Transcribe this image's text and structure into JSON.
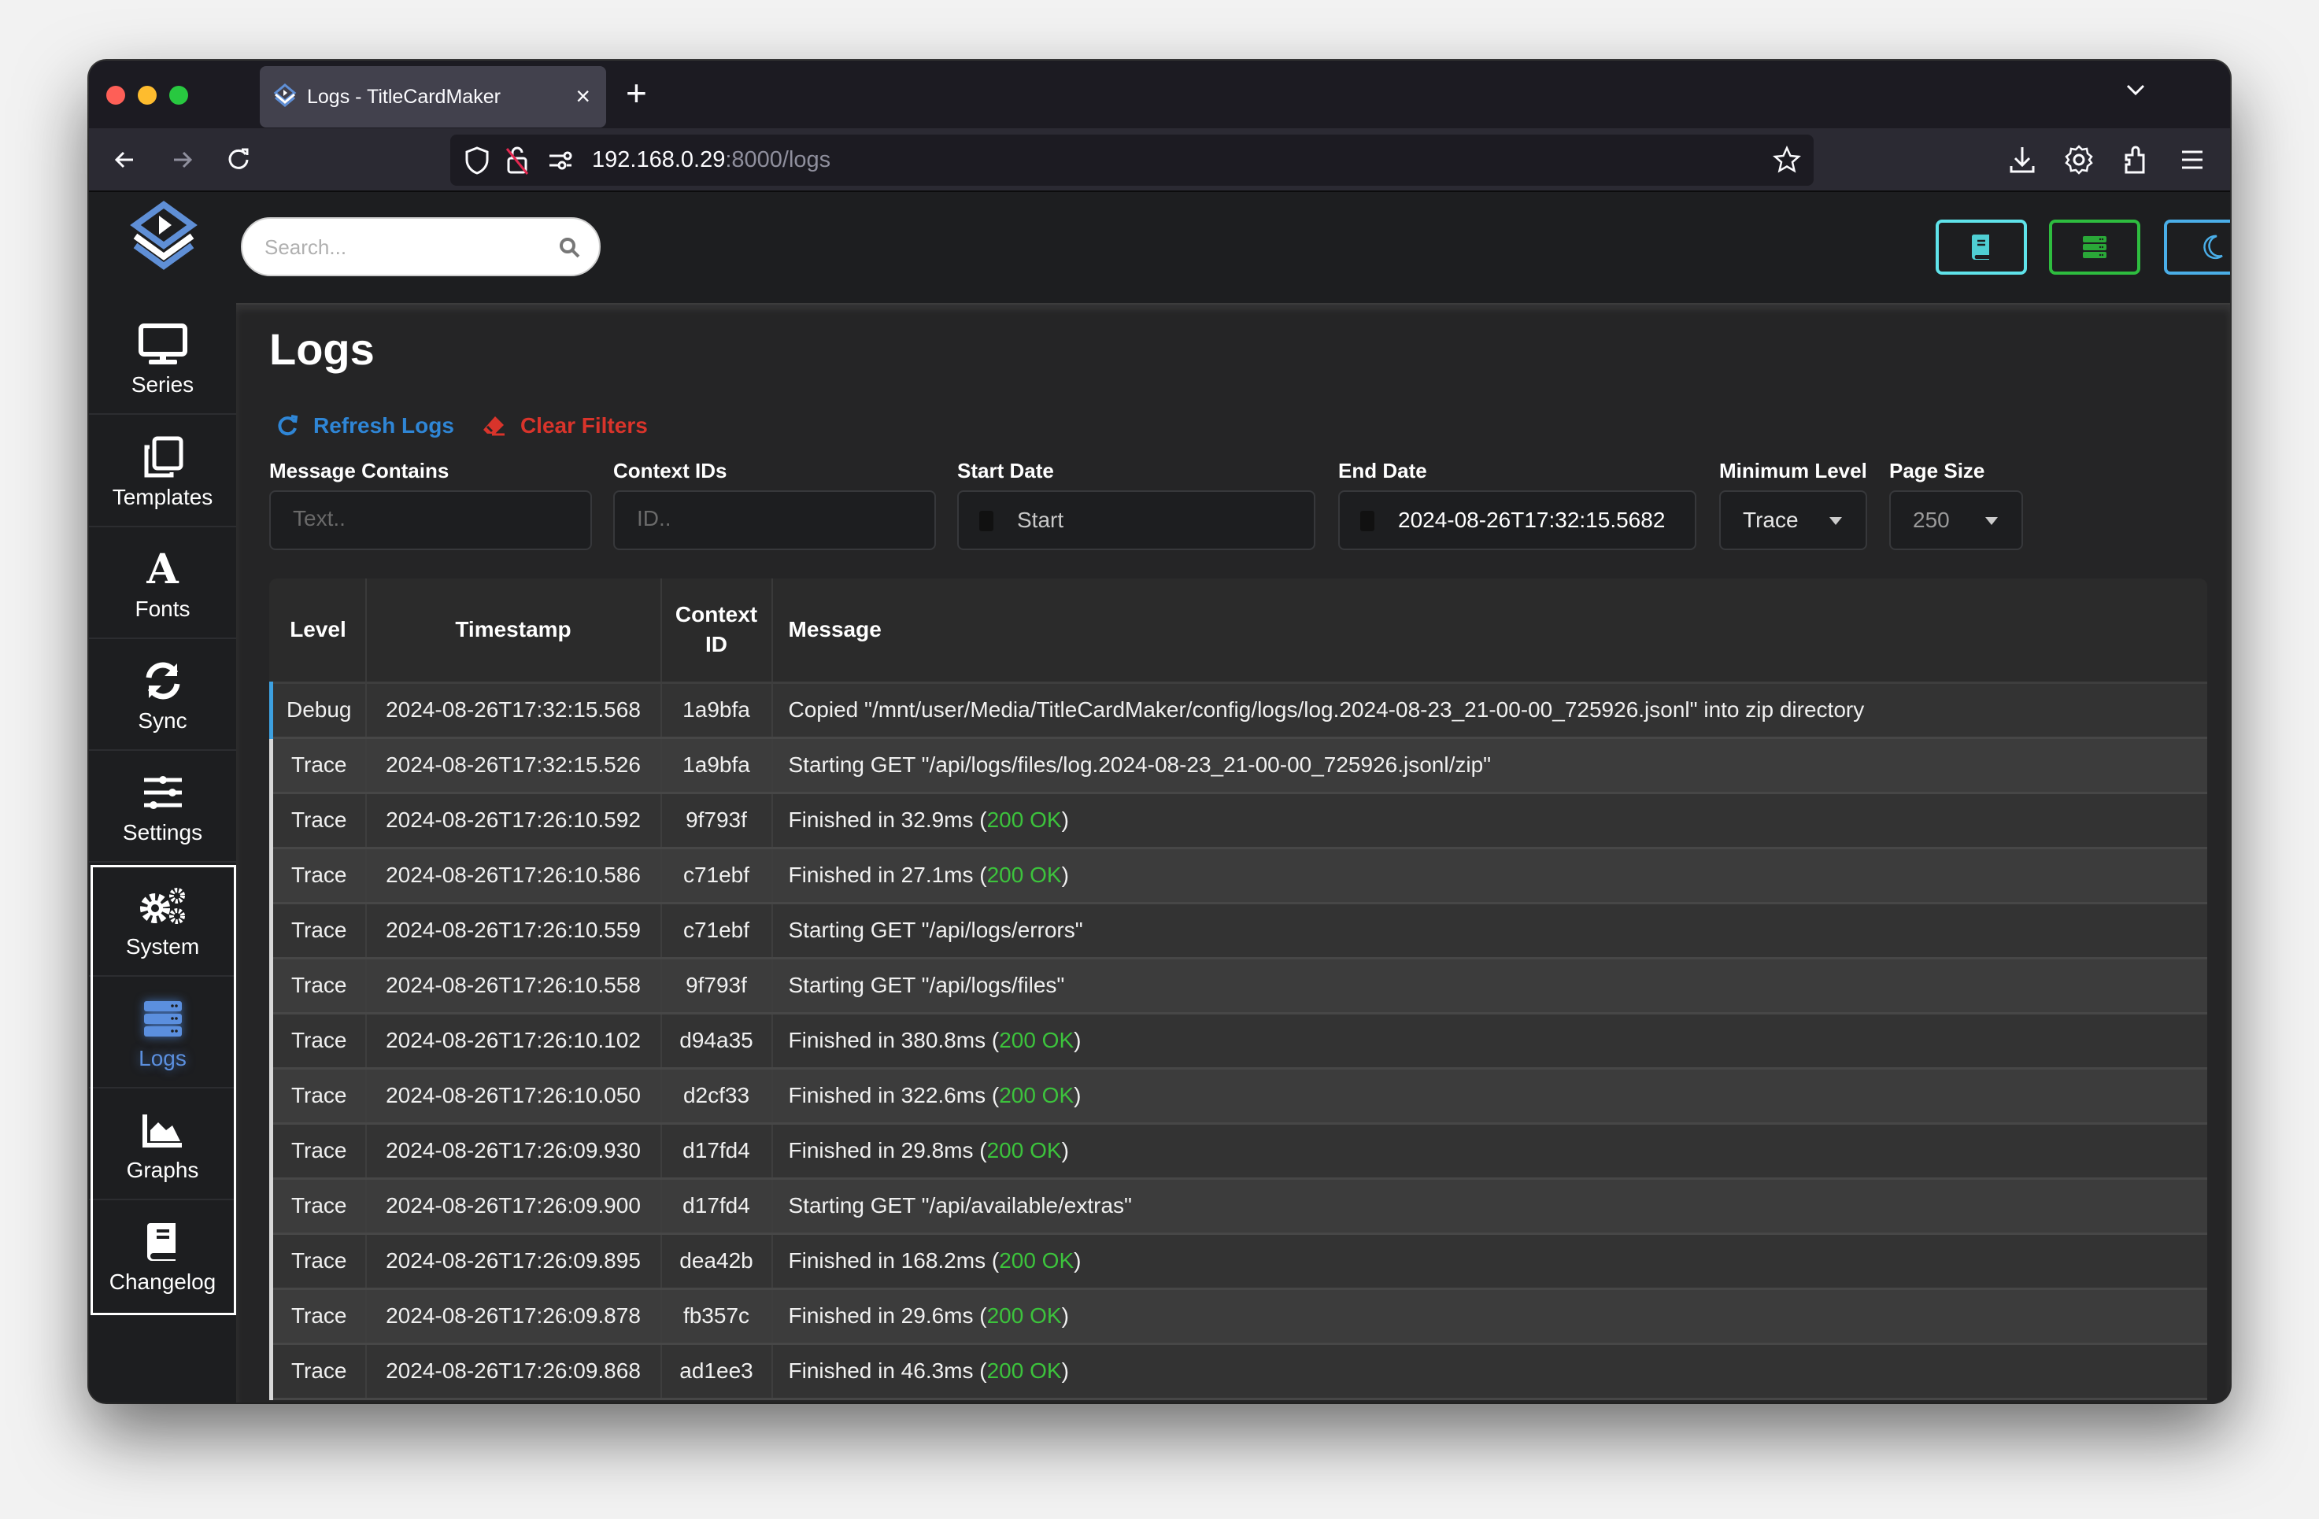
{
  "browser": {
    "tab_title": "Logs - TitleCardMaker",
    "url_host": "192.168.0.29",
    "url_path": ":8000/logs"
  },
  "app": {
    "search_placeholder": "Search...",
    "header_buttons": [
      {
        "name": "changelog-button",
        "icon": "book-icon",
        "color": "#5fe3ea"
      },
      {
        "name": "logs-button",
        "icon": "server-icon",
        "color": "#2ebd3f"
      },
      {
        "name": "theme-toggle-button",
        "icon": "moon-icon",
        "color": "#4aaee8"
      }
    ]
  },
  "sidebar": {
    "items": [
      {
        "label": "Series",
        "icon": "monitor-icon"
      },
      {
        "label": "Templates",
        "icon": "copy-icon"
      },
      {
        "label": "Fonts",
        "icon": "font-icon"
      },
      {
        "label": "Sync",
        "icon": "sync-icon"
      },
      {
        "label": "Settings",
        "icon": "sliders-icon"
      },
      {
        "label": "System",
        "icon": "gears-icon"
      },
      {
        "label": "Logs",
        "icon": "server-icon",
        "active": true
      },
      {
        "label": "Graphs",
        "icon": "chart-area-icon"
      },
      {
        "label": "Changelog",
        "icon": "book-icon"
      }
    ]
  },
  "page": {
    "title": "Logs",
    "refresh_label": "Refresh Logs",
    "clear_label": "Clear Filters",
    "colors": {
      "refresh": "#2f86d6",
      "clear": "#d9342b",
      "ok": "#3cc33c",
      "active": "#5b8fde"
    }
  },
  "filters": {
    "message_label": "Message Contains",
    "message_placeholder": "Text..",
    "context_label": "Context IDs",
    "context_placeholder": "ID..",
    "start_label": "Start Date",
    "start_placeholder": "Start",
    "end_label": "End Date",
    "end_value": "2024-08-26T17:32:15.5682",
    "level_label": "Minimum Level",
    "level_value": "Trace",
    "pagesize_label": "Page Size",
    "pagesize_value": "250"
  },
  "table": {
    "headers": {
      "level": "Level",
      "timestamp": "Timestamp",
      "context_l1": "Context",
      "context_l2": "ID",
      "message": "Message"
    },
    "rows": [
      {
        "level": "Debug",
        "timestamp": "2024-08-26T17:32:15.568",
        "context": "1a9bfa",
        "message": "Copied \"/mnt/user/Media/TitleCardMaker/config/logs/log.2024-08-23_21-00-00_725926.jsonl\" into zip directory",
        "status": ""
      },
      {
        "level": "Trace",
        "timestamp": "2024-08-26T17:32:15.526",
        "context": "1a9bfa",
        "message": "Starting GET \"/api/logs/files/log.2024-08-23_21-00-00_725926.jsonl/zip\"",
        "status": ""
      },
      {
        "level": "Trace",
        "timestamp": "2024-08-26T17:26:10.592",
        "context": "9f793f",
        "message": "Finished in 32.9ms (",
        "status": "200 OK"
      },
      {
        "level": "Trace",
        "timestamp": "2024-08-26T17:26:10.586",
        "context": "c71ebf",
        "message": "Finished in 27.1ms (",
        "status": "200 OK"
      },
      {
        "level": "Trace",
        "timestamp": "2024-08-26T17:26:10.559",
        "context": "c71ebf",
        "message": "Starting GET \"/api/logs/errors\"",
        "status": ""
      },
      {
        "level": "Trace",
        "timestamp": "2024-08-26T17:26:10.558",
        "context": "9f793f",
        "message": "Starting GET \"/api/logs/files\"",
        "status": ""
      },
      {
        "level": "Trace",
        "timestamp": "2024-08-26T17:26:10.102",
        "context": "d94a35",
        "message": "Finished in 380.8ms (",
        "status": "200 OK"
      },
      {
        "level": "Trace",
        "timestamp": "2024-08-26T17:26:10.050",
        "context": "d2cf33",
        "message": "Finished in 322.6ms (",
        "status": "200 OK"
      },
      {
        "level": "Trace",
        "timestamp": "2024-08-26T17:26:09.930",
        "context": "d17fd4",
        "message": "Finished in 29.8ms (",
        "status": "200 OK"
      },
      {
        "level": "Trace",
        "timestamp": "2024-08-26T17:26:09.900",
        "context": "d17fd4",
        "message": "Starting GET \"/api/available/extras\"",
        "status": ""
      },
      {
        "level": "Trace",
        "timestamp": "2024-08-26T17:26:09.895",
        "context": "dea42b",
        "message": "Finished in 168.2ms (",
        "status": "200 OK"
      },
      {
        "level": "Trace",
        "timestamp": "2024-08-26T17:26:09.878",
        "context": "fb357c",
        "message": "Finished in 29.6ms (",
        "status": "200 OK"
      },
      {
        "level": "Trace",
        "timestamp": "2024-08-26T17:26:09.868",
        "context": "ad1ee3",
        "message": "Finished in 46.3ms (",
        "status": "200 OK"
      }
    ]
  }
}
